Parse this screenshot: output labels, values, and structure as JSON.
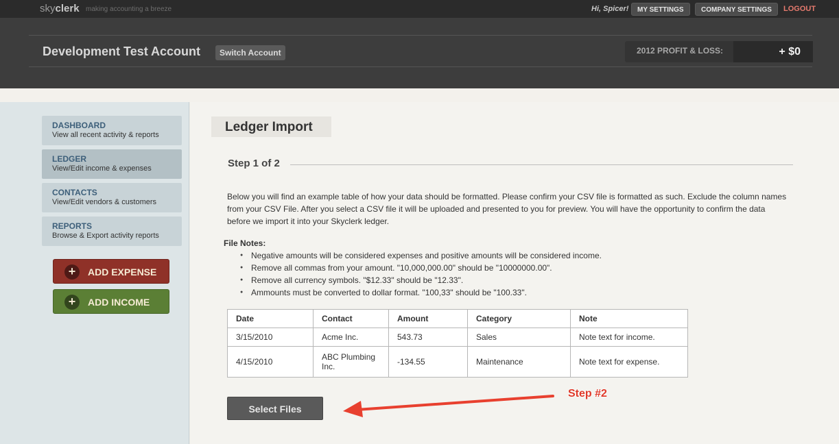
{
  "topbar": {
    "logo_light": "sky",
    "logo_bold": "clerk",
    "tagline": "making accounting a breeze",
    "greeting": "Hi, Spicer!",
    "my_settings": "MY SETTINGS",
    "company_settings": "COMPANY SETTINGS",
    "logout": "LOGOUT"
  },
  "account": {
    "title": "Development Test Account",
    "switch_label": "Switch Account",
    "pl_label": "2012 PROFIT & LOSS:",
    "pl_value": "+ $0"
  },
  "sidebar": {
    "items": [
      {
        "title": "DASHBOARD",
        "desc": "View all recent activity & reports"
      },
      {
        "title": "LEDGER",
        "desc": "View/Edit income & expenses"
      },
      {
        "title": "CONTACTS",
        "desc": "View/Edit vendors & customers"
      },
      {
        "title": "REPORTS",
        "desc": "Browse & Export activity reports"
      }
    ],
    "add_expense": "ADD EXPENSE",
    "add_income": "ADD INCOME",
    "plus": "+"
  },
  "main": {
    "heading": "Ledger Import",
    "step": "Step 1 of 2",
    "intro": "Below you will find an example table of how your data should be formatted. Please confirm your CSV file is formatted as such. Exclude the column names from your CSV File. After you select a CSV file it will be uploaded and presented to you for preview. You will have the opportunity to confirm the data before we import it into your Skyclerk ledger.",
    "notes_title": "File Notes:",
    "notes": [
      "Negative amounts will be considered expenses and positive amounts will be considered income.",
      "Remove all commas from your amount. \"10,000,000.00\" should be \"10000000.00\".",
      "Remove all currency symbols. \"$12.33\" should be \"12.33\".",
      "Ammounts must be converted to dollar format. \"100,33\" should be \"100.33\"."
    ],
    "table": {
      "headers": [
        "Date",
        "Contact",
        "Amount",
        "Category",
        "Note"
      ],
      "rows": [
        [
          "3/15/2010",
          "Acme Inc.",
          "543.73",
          "Sales",
          "Note text for income."
        ],
        [
          "4/15/2010",
          "ABC Plumbing Inc.",
          "-134.55",
          "Maintenance",
          "Note text for expense."
        ]
      ]
    },
    "select_files": "Select Files",
    "annotation": "Step #2"
  },
  "colors": {
    "topbar": "#2b2b2b",
    "header": "#3d3d3d",
    "nav_title": "#3d5f7a",
    "expense": "#8f3128",
    "income": "#5b7f35",
    "annotation": "#e03a2a",
    "logout": "#e67a6e"
  }
}
